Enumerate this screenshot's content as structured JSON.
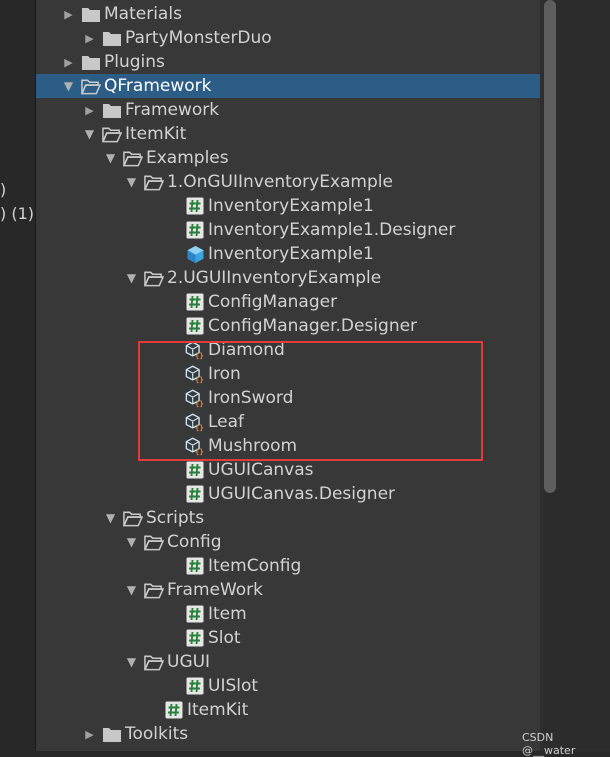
{
  "left_cut": {
    "line1": ")",
    "line2": ") (1)"
  },
  "watermark": "CSDN @__water",
  "tree": [
    {
      "label": "Materials",
      "type": "folder",
      "expanded": false
    },
    {
      "label": "PartyMonsterDuo",
      "type": "folder",
      "expanded": false
    },
    {
      "label": "Plugins",
      "type": "folder",
      "expanded": false
    },
    {
      "label": "QFramework",
      "type": "folder-open",
      "expanded": true,
      "selected": true
    },
    {
      "label": "Framework",
      "type": "folder",
      "expanded": false
    },
    {
      "label": "ItemKit",
      "type": "folder-open",
      "expanded": true
    },
    {
      "label": "Examples",
      "type": "folder-open",
      "expanded": true
    },
    {
      "label": "1.OnGUIInventoryExample",
      "type": "folder-open",
      "expanded": true
    },
    {
      "label": "InventoryExample1",
      "type": "script"
    },
    {
      "label": "InventoryExample1.Designer",
      "type": "script"
    },
    {
      "label": "InventoryExample1",
      "type": "prefab"
    },
    {
      "label": "2.UGUIInventoryExample",
      "type": "folder-open",
      "expanded": true
    },
    {
      "label": "ConfigManager",
      "type": "script"
    },
    {
      "label": "ConfigManager.Designer",
      "type": "script"
    },
    {
      "label": "Diamond",
      "type": "scriptable-object"
    },
    {
      "label": "Iron",
      "type": "scriptable-object"
    },
    {
      "label": "IronSword",
      "type": "scriptable-object"
    },
    {
      "label": "Leaf",
      "type": "scriptable-object"
    },
    {
      "label": "Mushroom",
      "type": "scriptable-object"
    },
    {
      "label": "UGUICanvas",
      "type": "script"
    },
    {
      "label": "UGUICanvas.Designer",
      "type": "script"
    },
    {
      "label": "Scripts",
      "type": "folder-open",
      "expanded": true
    },
    {
      "label": "Config",
      "type": "folder-open",
      "expanded": true
    },
    {
      "label": "ItemConfig",
      "type": "script"
    },
    {
      "label": "FrameWork",
      "type": "folder-open",
      "expanded": true
    },
    {
      "label": "Item",
      "type": "script"
    },
    {
      "label": "Slot",
      "type": "script"
    },
    {
      "label": "UGUI",
      "type": "folder-open",
      "expanded": true
    },
    {
      "label": "UISlot",
      "type": "script"
    },
    {
      "label": "ItemKit",
      "type": "script"
    },
    {
      "label": "Toolkits",
      "type": "folder",
      "expanded": false
    }
  ]
}
